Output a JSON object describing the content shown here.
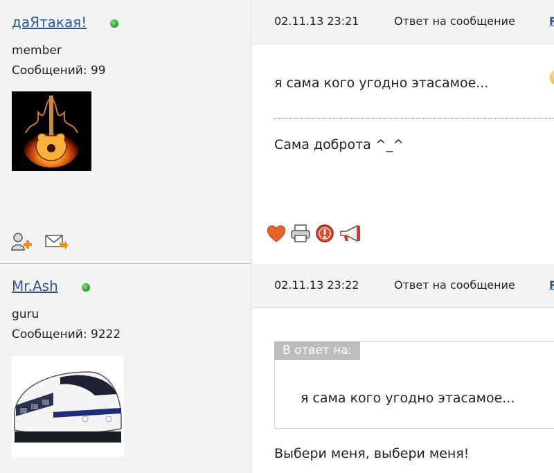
{
  "posts": [
    {
      "author": "даЯтакая!",
      "rank": "member",
      "message_count": "Сообщений: 99",
      "date": "02.11.13 23:21",
      "reply_label": "Ответ на сообщение",
      "topic_link": "R",
      "text": "я сама кого угодно этасамое...",
      "signature": "Сама доброта ^_^",
      "avatar_icon": "flaming-guitar-avatar"
    },
    {
      "author": "Mr.Ash",
      "rank": "guru",
      "message_count": "Сообщений: 9222",
      "date": "02.11.13 23:22",
      "reply_label": "Ответ на сообщение",
      "topic_link": "R",
      "quote_label": "В ответ на:",
      "quote_text": "я сама кого угодно этасамое...",
      "text": "Выбери меня, выбери меня!",
      "avatar_icon": "train-avatar"
    }
  ],
  "colors": {
    "link": "#2b5797",
    "online": "#2ea52e",
    "sidebar_bg": "#f3f3f3"
  }
}
